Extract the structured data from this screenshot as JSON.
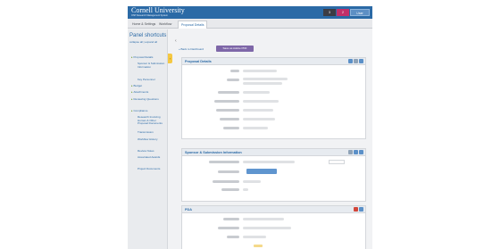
{
  "header": {
    "title": "Cornell University",
    "subtitle": "OSP Research Management System",
    "badge_dark": "3",
    "badge_red": "2",
    "user_menu": "User"
  },
  "tabs": [
    {
      "label": "Home & Settings"
    },
    {
      "label": "Workflow"
    },
    {
      "label": "Proposal Details"
    }
  ],
  "sidebar": {
    "title": "Panel shortcuts",
    "links": "collapse all | expand all",
    "items": [
      {
        "label": "Proposal Details"
      },
      {
        "label": "Sponsor & Submission Information"
      },
      {
        "label": "Key Personnel"
      },
      {
        "label": "Budget"
      },
      {
        "label": "Attachments"
      },
      {
        "label": "Reviewing Questions"
      },
      {
        "label": "Compliance"
      },
      {
        "label": "Research Involving Human & Other Proposal Documents"
      },
      {
        "label": "Transmission"
      },
      {
        "label": "Workflow History"
      },
      {
        "label": "Review Notes"
      },
      {
        "label": "Associated Awards"
      },
      {
        "label": "Project Documents"
      }
    ]
  },
  "collapse_handle": "‹",
  "toolbar": {
    "back_link": "« Back to Dashboard",
    "pdf_button": "Save as Adobe PDF"
  },
  "panels": {
    "proposal_details": {
      "title": "Proposal Details"
    },
    "sponsor_submission": {
      "title": "Sponsor & Submission Information"
    },
    "pda": {
      "title": "PDA"
    }
  }
}
